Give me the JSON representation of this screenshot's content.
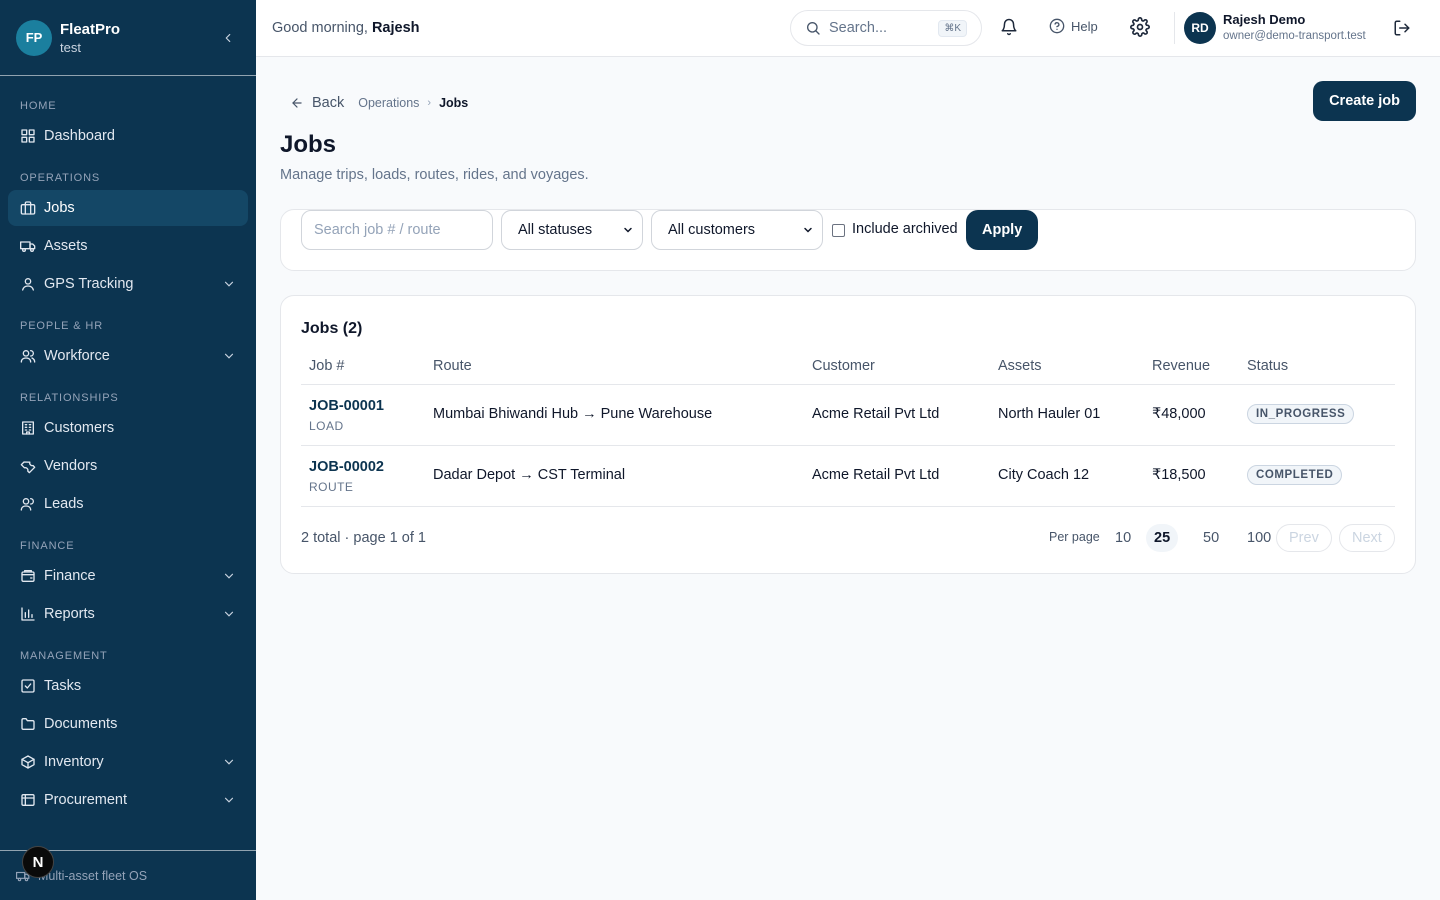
{
  "brand": {
    "initials": "FP",
    "name": "FleatPro",
    "sub": "test"
  },
  "sidebar": {
    "sections": [
      {
        "label": "HOME",
        "items": [
          {
            "label": "Dashboard",
            "icon": "dashboard-icon"
          }
        ]
      },
      {
        "label": "OPERATIONS",
        "items": [
          {
            "label": "Jobs",
            "icon": "briefcase-icon",
            "active": true
          },
          {
            "label": "Assets",
            "icon": "truck-icon"
          },
          {
            "label": "GPS Tracking",
            "icon": "map-pin-icon",
            "expandable": true
          }
        ]
      },
      {
        "label": "PEOPLE & HR",
        "items": [
          {
            "label": "Workforce",
            "icon": "users-icon",
            "expandable": true
          }
        ]
      },
      {
        "label": "RELATIONSHIPS",
        "items": [
          {
            "label": "Customers",
            "icon": "building-icon"
          },
          {
            "label": "Vendors",
            "icon": "wrench-icon"
          },
          {
            "label": "Leads",
            "icon": "user-plus-icon"
          }
        ]
      },
      {
        "label": "FINANCE",
        "items": [
          {
            "label": "Finance",
            "icon": "wallet-icon",
            "expandable": true
          },
          {
            "label": "Reports",
            "icon": "bar-chart-icon",
            "expandable": true
          }
        ]
      },
      {
        "label": "MANAGEMENT",
        "items": [
          {
            "label": "Tasks",
            "icon": "checkbox-icon"
          },
          {
            "label": "Documents",
            "icon": "folder-icon"
          },
          {
            "label": "Inventory",
            "icon": "package-icon",
            "expandable": true
          },
          {
            "label": "Procurement",
            "icon": "cart-icon",
            "expandable": true
          }
        ]
      }
    ],
    "footer_text": "Multi-asset fleet OS",
    "footer_badge": "N"
  },
  "topbar": {
    "greeting": "Good morning,",
    "greeting_name": "Rajesh",
    "search_label": "Search...",
    "search_kbd": "⌘K",
    "help_label": "Help",
    "user_initials": "RD",
    "user_name": "Rajesh Demo",
    "user_email": "owner@demo-transport.test"
  },
  "page": {
    "back_label": "Back",
    "breadcrumb": [
      "Operations",
      "Jobs"
    ],
    "create_label": "Create job",
    "title": "Jobs",
    "subtitle": "Manage trips, loads, routes, rides, and voyages."
  },
  "filters": {
    "search_placeholder": "Search job # / route",
    "status_value": "All statuses",
    "customer_value": "All customers",
    "archived_label": "Include archived",
    "apply_label": "Apply"
  },
  "jobs": {
    "title": "Jobs (2)",
    "columns": [
      "Job #",
      "Route",
      "Customer",
      "Assets",
      "Revenue",
      "Status"
    ],
    "rows": [
      {
        "job": "JOB-00001",
        "type": "LOAD",
        "route": "Mumbai Bhiwandi Hub → Pune Warehouse",
        "customer": "Acme Retail Pvt Ltd",
        "assets": "North Hauler 01",
        "revenue": "₹48,000",
        "status": "IN_PROGRESS"
      },
      {
        "job": "JOB-00002",
        "type": "ROUTE",
        "route": "Dadar Depot → CST Terminal",
        "customer": "Acme Retail Pvt Ltd",
        "assets": "City Coach 12",
        "revenue": "₹18,500",
        "status": "COMPLETED"
      }
    ],
    "pager_text": "2 total · page 1 of 1",
    "per_page_label": "Per page",
    "per_page_options": [
      "10",
      "25",
      "50",
      "100"
    ],
    "per_page_selected": "25",
    "prev_label": "Prev",
    "next_label": "Next"
  },
  "colors": {
    "sidebar_bg": "#0c3450",
    "accent": "#0c3450",
    "brand_avatar": "#1b7f9e"
  }
}
